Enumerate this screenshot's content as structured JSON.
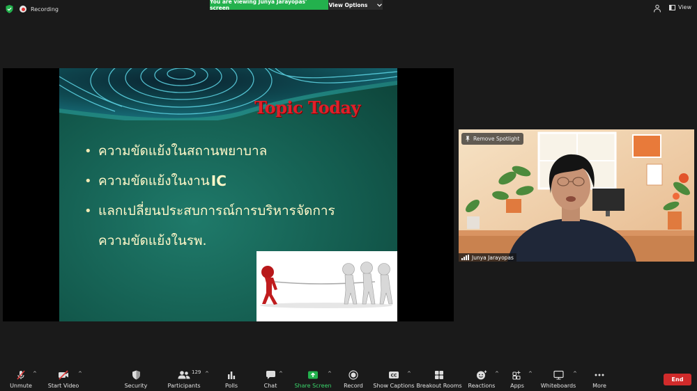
{
  "topbar": {
    "recording_label": "Recording",
    "banner_text": "You are viewing Junya Jarayopas' screen",
    "view_options_label": "View Options",
    "view_label": "View"
  },
  "slide": {
    "title": "Topic Today",
    "bullets": [
      {
        "text": "ความขัดแย้งในสถานพยาบาล"
      },
      {
        "text": "ความขัดแย้งในงาน",
        "emphasis": "IC"
      },
      {
        "text": "แลกเปลี่ยนประสบการณ์การบริหารจัดการ",
        "continuation": "ความขัดแย้งในรพ."
      }
    ]
  },
  "video": {
    "remove_spotlight_label": "Remove Spotlight",
    "participant_name": "Junya Jarayopas"
  },
  "toolbar": {
    "unmute": "Unmute",
    "start_video": "Start Video",
    "security": "Security",
    "participants": "Participants",
    "participants_count": "129",
    "polls": "Polls",
    "chat": "Chat",
    "share_screen": "Share Screen",
    "record": "Record",
    "show_captions": "Show Captions",
    "breakout_rooms": "Breakout Rooms",
    "reactions": "Reactions",
    "apps": "Apps",
    "whiteboards": "Whiteboards",
    "more": "More",
    "end": "End"
  },
  "colors": {
    "banner_green": "#23b14d",
    "share_green": "#3ad56b",
    "end_red": "#d12b2b",
    "slide_title_red": "#e0202a",
    "slide_bg": "#135a4d"
  }
}
